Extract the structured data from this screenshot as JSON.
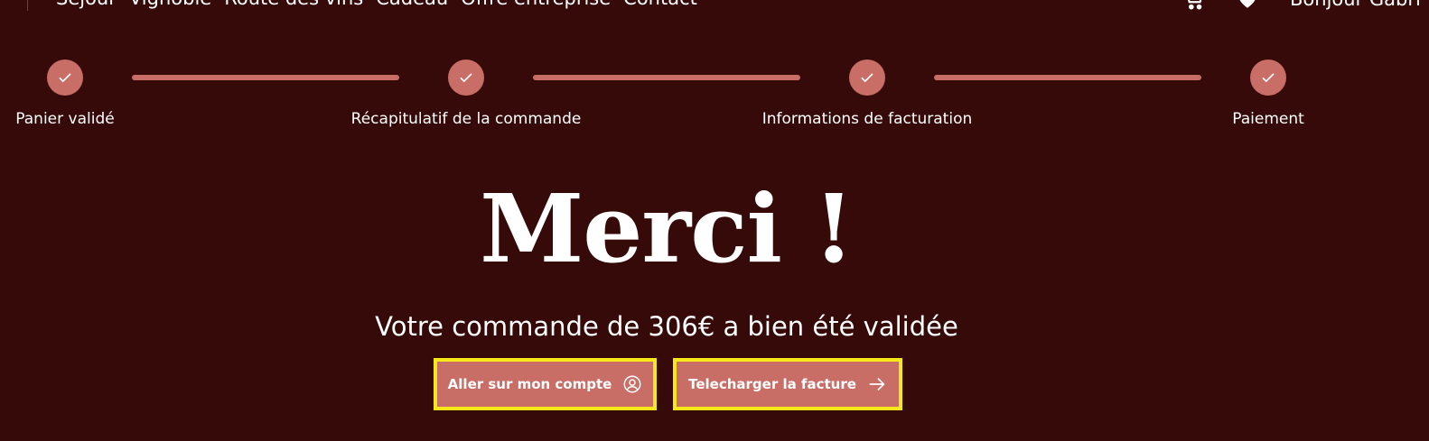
{
  "nav": {
    "links": [
      "Séjour",
      "Vignoble",
      "Route des vins",
      "Cadeau",
      "Offre entreprise",
      "Contact"
    ],
    "greeting": "Bonjour Gabri",
    "icons": [
      "cart-icon",
      "heart-icon"
    ]
  },
  "stepper": {
    "steps": [
      {
        "label": "Panier validé",
        "status": "completed"
      },
      {
        "label": "Récapitulatif de la commande",
        "status": "completed"
      },
      {
        "label": "Informations de facturation",
        "status": "completed"
      },
      {
        "label": "Paiement",
        "status": "completed"
      }
    ]
  },
  "hero": {
    "title": "Merci !",
    "subtitle": "Votre commande de 306€ a bien été validée"
  },
  "actions": {
    "account_label": "Aller sur mon compte",
    "account_icon": "user-circle-icon",
    "invoice_label": "Telecharger la facture",
    "invoice_icon": "arrow-right-icon"
  },
  "colors": {
    "background": "#360a08",
    "accent": "#c96e67",
    "highlight_border": "#f7e81a",
    "text": "#ffffff"
  }
}
